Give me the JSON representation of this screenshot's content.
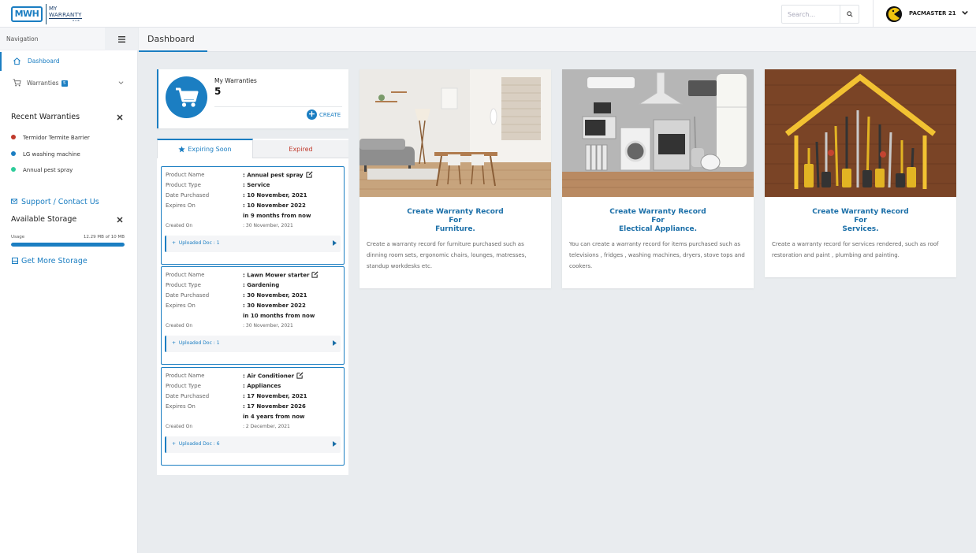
{
  "logo": {
    "abbr": "MWH",
    "line1": "MY",
    "line2": "WARRANTY",
    "line3": "HUB"
  },
  "search": {
    "placeholder": "Search..."
  },
  "user": {
    "name": "PACMASTER 21"
  },
  "nav": {
    "heading": "Navigation",
    "items": [
      {
        "label": "Dashboard",
        "active": true
      },
      {
        "label": "Warranties",
        "badge": "5"
      }
    ]
  },
  "recent": {
    "title": "Recent Warranties",
    "items": [
      {
        "label": "Termidor Termite Barrier",
        "color": "#c0392b"
      },
      {
        "label": "LG washing machine",
        "color": "#1b7ec2"
      },
      {
        "label": "Annual pest spray",
        "color": "#2ecc9a"
      }
    ]
  },
  "support": {
    "label": "Support / Contact Us"
  },
  "storage": {
    "title": "Available Storage",
    "usage_label": "Usage",
    "usage_value": "12.29 MB of 10 MB",
    "usage_fraction": 1.0,
    "get_more": "Get More Storage"
  },
  "page": {
    "title": "Dashboard"
  },
  "my_warranties": {
    "label": "My Warranties",
    "count": "5",
    "create": "CREATE"
  },
  "tabs": {
    "expiring": "Expiring Soon",
    "expired": "Expired"
  },
  "field_labels": {
    "name": "Product Name",
    "type": "Product Type",
    "purchased": "Date Purchased",
    "expires": "Expires On",
    "created": "Created On"
  },
  "warranties": [
    {
      "name": ": Annual pest spray",
      "type": ": Service",
      "purchased": ": 10 November, 2021",
      "expires": ": 10 November 2022",
      "relative": "in 9 months from now",
      "created": ": 30 November, 2021",
      "docs": "Uploaded Doc : 1"
    },
    {
      "name": ": Lawn Mower starter",
      "type": ": Gardening",
      "purchased": ": 30 November, 2021",
      "expires": ": 30 November 2022",
      "relative": "in 10 months from now",
      "created": ": 30 November, 2021",
      "docs": "Uploaded Doc : 1"
    },
    {
      "name": ": Air Conditioner",
      "type": ": Appliances",
      "purchased": ": 17 November, 2021",
      "expires": ": 17 November 2026",
      "relative": "in 4 years from now",
      "created": ": 2 December, 2021",
      "docs": "Uploaded Doc : 6"
    }
  ],
  "categories": [
    {
      "h1": "Create Warranty Record",
      "h2": "For",
      "h3": "Furniture.",
      "desc": "Create a warranty record for furniture purchased such as dinning room sets, ergonomic chairs, lounges, matresses, standup workdesks etc."
    },
    {
      "h1": "Create Warranty Record",
      "h2": "For",
      "h3": "Electical Appliance.",
      "desc": "You can create a warranty record for items purchased such as televisions , fridges , washing machines, dryers, stove tops and cookers."
    },
    {
      "h1": "Create Warranty Record",
      "h2": "For",
      "h3": "Services.",
      "desc": "Create a warranty record for services rendered, such as roof restoration and paint , plumbing and painting."
    }
  ]
}
